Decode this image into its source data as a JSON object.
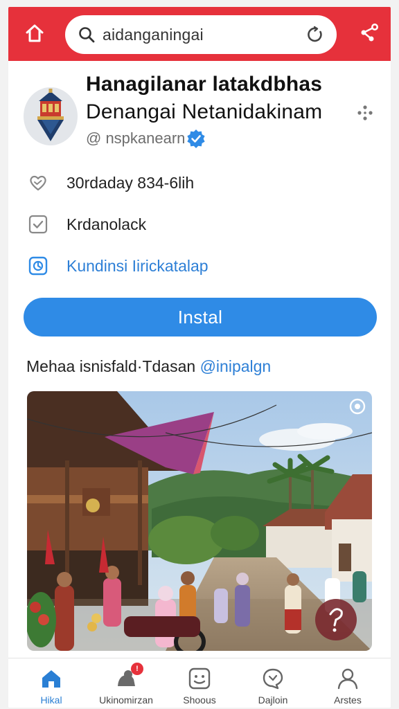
{
  "topbar": {
    "background": "#e6313b",
    "search_text": "aidanganingai",
    "icons": [
      "home-icon",
      "search-icon",
      "refresh-icon",
      "share-icon"
    ]
  },
  "profile": {
    "title_line1": "Hanagilanar latakdbhas",
    "title_line2": "Denangai Netanidakinam",
    "handle": "@ nspkanearn",
    "verified": true
  },
  "info": {
    "rows": [
      {
        "icon": "heart-icon",
        "text": "30rdaday 834-6lih"
      },
      {
        "icon": "checkbox-icon",
        "text": "Krdanolack"
      },
      {
        "icon": "clock-icon",
        "text": "Kundinsi Iirickatalap"
      }
    ]
  },
  "install": {
    "label": "Instal",
    "color": "#2f8be6"
  },
  "subline": {
    "text": "Mehaa isnisfald·Tdasan ",
    "mention": "@inipalgn"
  },
  "nav": {
    "items": [
      {
        "label": "Hikal",
        "icon": "home-icon",
        "active": true
      },
      {
        "label": "Ukinomirzan",
        "icon": "pet-icon",
        "badge": "!"
      },
      {
        "label": "Shoous",
        "icon": "face-icon"
      },
      {
        "label": "Dajloin",
        "icon": "chat-icon"
      },
      {
        "label": "Arstes",
        "icon": "user-icon"
      }
    ]
  },
  "accent": "#2d7fd6"
}
